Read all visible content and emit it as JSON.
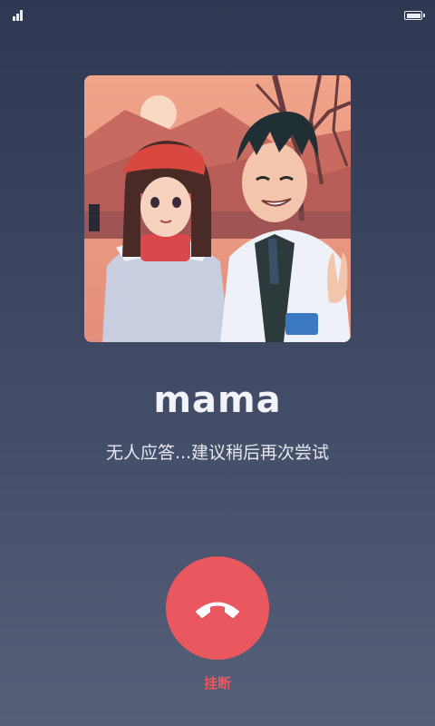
{
  "status_bar": {
    "signal_icon": "signal-bars-icon",
    "battery_icon": "battery-full-icon"
  },
  "contact": {
    "avatar_icon": "contact-avatar-illustration",
    "name": "mama"
  },
  "call": {
    "status_text": "无人应答...建议稍后再次尝试",
    "hangup_icon": "phone-hangup-icon",
    "hangup_label": "挂断"
  },
  "colors": {
    "background_top": "#2f3852",
    "background_bottom": "#565f78",
    "hangup_red": "#e9575f",
    "text_primary": "#f1f3f8"
  }
}
